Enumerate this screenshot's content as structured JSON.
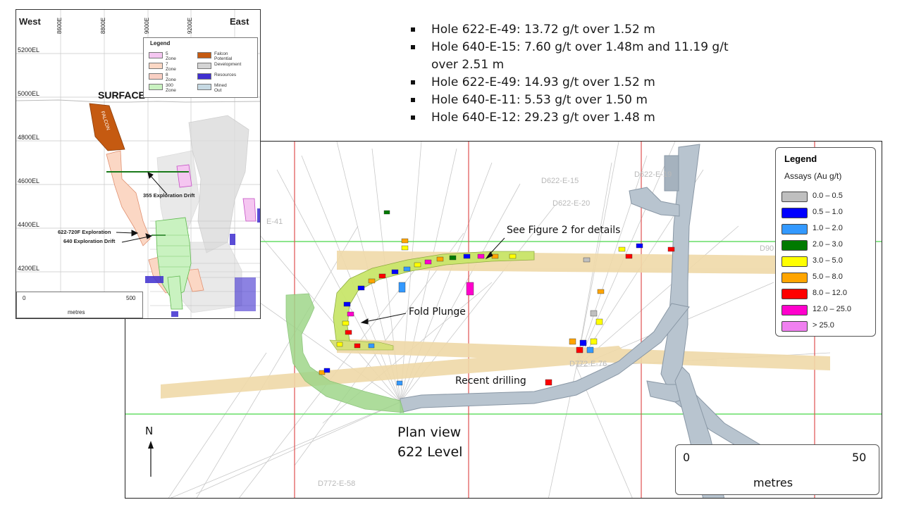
{
  "bullets": [
    "Hole 622-E-49: 13.72 g/t over 1.52 m",
    "Hole 640-E-15: 7.60 g/t over 1.48m and 11.19 g/t over 2.51 m",
    "Hole 622-E-49: 14.93 g/t over 1.52 m",
    "Hole 640-E-11: 5.53 g/t over 1.50 m",
    "Hole 640-E-12: 29.23 g/t over 1.48 m"
  ],
  "section": {
    "west": "West",
    "east": "East",
    "eastings": [
      "8600E",
      "8800E",
      "9000E",
      "9200E"
    ],
    "elevations": [
      "5200EL",
      "5000EL",
      "4800EL",
      "4600EL",
      "4400EL",
      "4200EL"
    ],
    "surface": "SURFACE",
    "falcon": "FALCON",
    "drift_355": "355 Exploration  Drift",
    "exploration_622": "622-720F Exploration",
    "drift_640": "640 Exploration  Drift",
    "legend": {
      "title": "Legend",
      "items": [
        {
          "label": "5 Zone",
          "color": "#f5c6f1"
        },
        {
          "label": "7 Zone",
          "color": "#fbd7c4"
        },
        {
          "label": "8 Zone",
          "color": "#f9cfc3"
        },
        {
          "label": "300 Zone",
          "color": "#c9f2c0"
        },
        {
          "label": "Falcon Potential",
          "color": "#c55a11"
        },
        {
          "label": "Development",
          "color": "#d4d4d4"
        },
        {
          "label": "Resources",
          "color": "#3f2fd0"
        },
        {
          "label": "Mined Out",
          "color": "#c6d9e3"
        }
      ]
    },
    "scale": {
      "start": "0",
      "end": "500",
      "unit": "metres"
    }
  },
  "plan": {
    "holes": [
      "D622-E-15",
      "D622-E-20",
      "D622-E-19",
      "D772-E-58",
      "E-41",
      "D90",
      "D772-E-76"
    ],
    "see_figure": "See Figure 2 for details",
    "fold_plunge": "Fold Plunge",
    "recent_drilling": "Recent drilling",
    "plan_view": "Plan view",
    "level": "622 Level",
    "north": "N",
    "legend": {
      "title": "Legend",
      "subtitle": "Assays (Au g/t)",
      "items": [
        {
          "label": "0.0 – 0.5",
          "color": "#bfbfbf"
        },
        {
          "label": "0.5 – 1.0",
          "color": "#0000ff"
        },
        {
          "label": "1.0 – 2.0",
          "color": "#3399ff"
        },
        {
          "label": "2.0 – 3.0",
          "color": "#007a00"
        },
        {
          "label": "3.0 – 5.0",
          "color": "#ffff00"
        },
        {
          "label": "5.0 – 8.0",
          "color": "#ffa500"
        },
        {
          "label": "8.0 – 12.0",
          "color": "#ff0000"
        },
        {
          "label": "12.0 – 25.0",
          "color": "#ff00cc"
        },
        {
          "label": "> 25.0",
          "color": "#f080f0"
        }
      ]
    },
    "scale": {
      "start": "0",
      "end": "50",
      "unit": "metres"
    }
  }
}
